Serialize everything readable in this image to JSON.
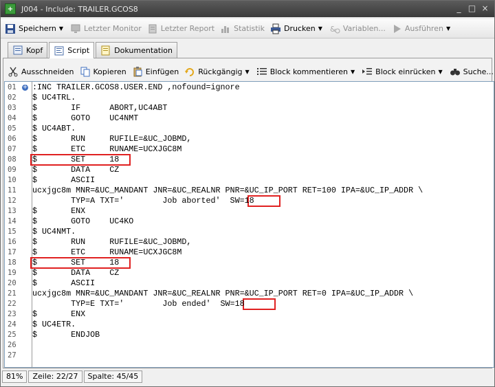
{
  "window": {
    "title": "J004 - Include: TRAILER.GCOS8",
    "controls": {
      "minimize": "_",
      "maximize": "□",
      "close": "×"
    }
  },
  "toolbar": {
    "save": "Speichern",
    "last_monitor": "Letzter Monitor",
    "last_report": "Letzter Report",
    "statistics": "Statistik",
    "print": "Drucken",
    "variables": "Variablen...",
    "execute": "Ausführen"
  },
  "tabs": [
    {
      "label": "Kopf",
      "active": false
    },
    {
      "label": "Script",
      "active": true
    },
    {
      "label": "Dokumentation",
      "active": false
    }
  ],
  "edit_toolbar": {
    "cut": "Ausschneiden",
    "copy": "Kopieren",
    "paste": "Einfügen",
    "undo": "Rückgängig",
    "comment_block": "Block kommentieren",
    "indent_block": "Block einrücken",
    "search": "Suche..."
  },
  "editor": {
    "line_numbers": [
      "01",
      "02",
      "03",
      "04",
      "05",
      "06",
      "07",
      "08",
      "09",
      "10",
      "11",
      "12",
      "13",
      "14",
      "15",
      "16",
      "17",
      "18",
      "19",
      "20",
      "21",
      "22",
      "23",
      "24",
      "25",
      "26",
      "27"
    ],
    "lines": [
      ":INC TRAILER.GCOS8.USER.END ,nofound=ignore",
      "$ UC4TRL.",
      "$       IF      ABORT,UC4ABT",
      "$       GOTO    UC4NMT",
      "$ UC4ABT.",
      "$       RUN     RUFILE=&UC_JOBMD,",
      "$       ETC     RUNAME=UCXJGC8M",
      "$       SET     18",
      "$       DATA    CZ",
      "$       ASCII",
      "ucxjgc8m MNR=&UC_MANDANT JNR=&UC_REALNR PNR=&UC_IP_PORT RET=100 IPA=&UC_IP_ADDR \\",
      "        TYP=A TXT='        Job aborted'  SW=18",
      "$       ENX",
      "$       GOTO    UC4KO",
      "$ UC4NMT.",
      "$       RUN     RUFILE=&UC_JOBMD,",
      "$       ETC     RUNAME=UCXJGC8M",
      "$       SET     18",
      "$       DATA    CZ",
      "$       ASCII",
      "ucxjgc8m MNR=&UC_MANDANT JNR=&UC_REALNR PNR=&UC_IP_PORT RET=0 IPA=&UC_IP_ADDR \\",
      "        TYP=E TXT='        Job ended'  SW=18",
      "$       ENX",
      "$ UC4ETR.",
      "$       ENDJOB",
      "",
      ""
    ]
  },
  "status": {
    "zoom": "81%",
    "line": "Zeile: 22/27",
    "column": "Spalte: 45/45"
  },
  "colors": {
    "highlight": "#e02020",
    "accent_blue": "#3f6fbf"
  }
}
